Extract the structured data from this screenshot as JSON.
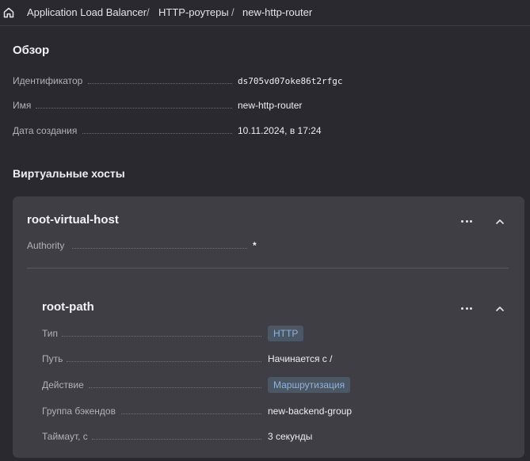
{
  "breadcrumbs": {
    "home_icon": "home-icon",
    "items": [
      "Application Load Balancer",
      "HTTP-роутеры",
      "new-http-router"
    ],
    "separator": "/"
  },
  "overview": {
    "title": "Обзор",
    "fields": [
      {
        "label": "Идентификатор",
        "value": "ds705vd07oke86t2rfgc"
      },
      {
        "label": "Имя",
        "value": "new-http-router"
      },
      {
        "label": "Дата создания",
        "value": "10.11.2024, в 17:24"
      }
    ]
  },
  "virtual_hosts": {
    "title": "Виртуальные хосты",
    "host": {
      "name": "root-virtual-host",
      "authority_label": "Authority",
      "authority_value": "*",
      "route": {
        "name": "root-path",
        "type_label": "Тип",
        "type_value": "HTTP",
        "path_label": "Путь",
        "path_value": "Начинается с /",
        "action_label": "Действие",
        "action_value": "Маршрутизация",
        "backend_group_label": "Группа бэкендов",
        "backend_group_value": "new-backend-group",
        "timeout_label": "Таймаут, с",
        "timeout_value": "3 секунды"
      }
    }
  },
  "icons": {
    "more": "more-horizontal-icon",
    "collapse": "chevron-up-icon"
  },
  "colors": {
    "background": "#2a292f",
    "card": "#3f3e45",
    "link": "#5a93f0",
    "tag_bg": "#4c5766",
    "tag_text": "#8fb2dc"
  }
}
